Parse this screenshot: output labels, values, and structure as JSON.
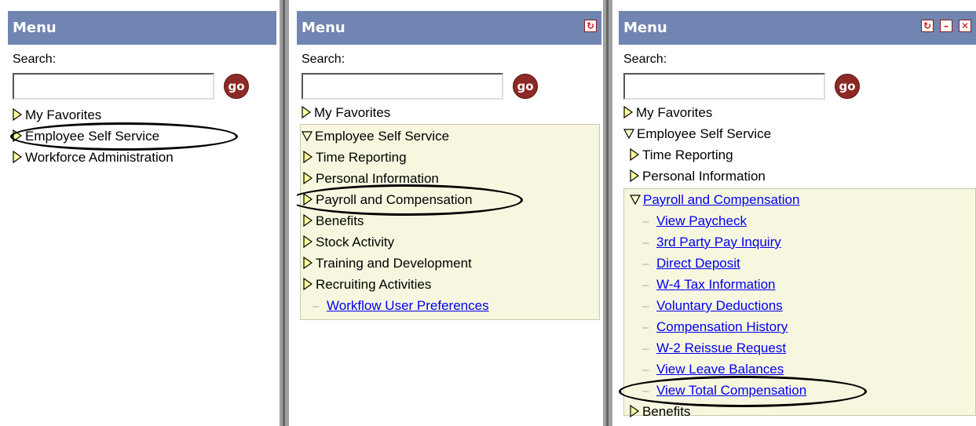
{
  "panels": [
    {
      "title": "Menu",
      "search_label": "Search:",
      "go_label": "go",
      "items": [
        {
          "label": "My Favorites"
        },
        {
          "label": "Employee Self Service"
        },
        {
          "label": "Workforce Administration"
        }
      ]
    },
    {
      "title": "Menu",
      "search_label": "Search:",
      "go_label": "go",
      "favorites": "My Favorites",
      "expanded": "Employee Self Service",
      "children": [
        "Time Reporting",
        "Personal Information",
        "Payroll and Compensation",
        "Benefits",
        "Stock Activity",
        "Training and Development",
        "Recruiting Activities"
      ],
      "link": "Workflow User Preferences"
    },
    {
      "title": "Menu",
      "search_label": "Search:",
      "go_label": "go",
      "favorites": "My Favorites",
      "expanded": "Employee Self Service",
      "children": [
        "Time Reporting",
        "Personal Information"
      ],
      "sub_expanded": "Payroll and Compensation",
      "links": [
        "View Paycheck",
        "3rd Party Pay Inquiry",
        "Direct Deposit",
        "W-4 Tax Information",
        "Voluntary Deductions",
        "Compensation History",
        "W-2 Reissue Request",
        "View Leave Balances",
        "View Total Compensation"
      ],
      "after": "Benefits"
    }
  ],
  "icons": {
    "refresh": "refresh-icon",
    "minimize": "minimize-icon",
    "close": "close-icon"
  },
  "colors": {
    "titlebar": "#7085b2",
    "highlight": "#f7f7e0",
    "link": "#0000ee",
    "go_button": "#8e2a25"
  }
}
